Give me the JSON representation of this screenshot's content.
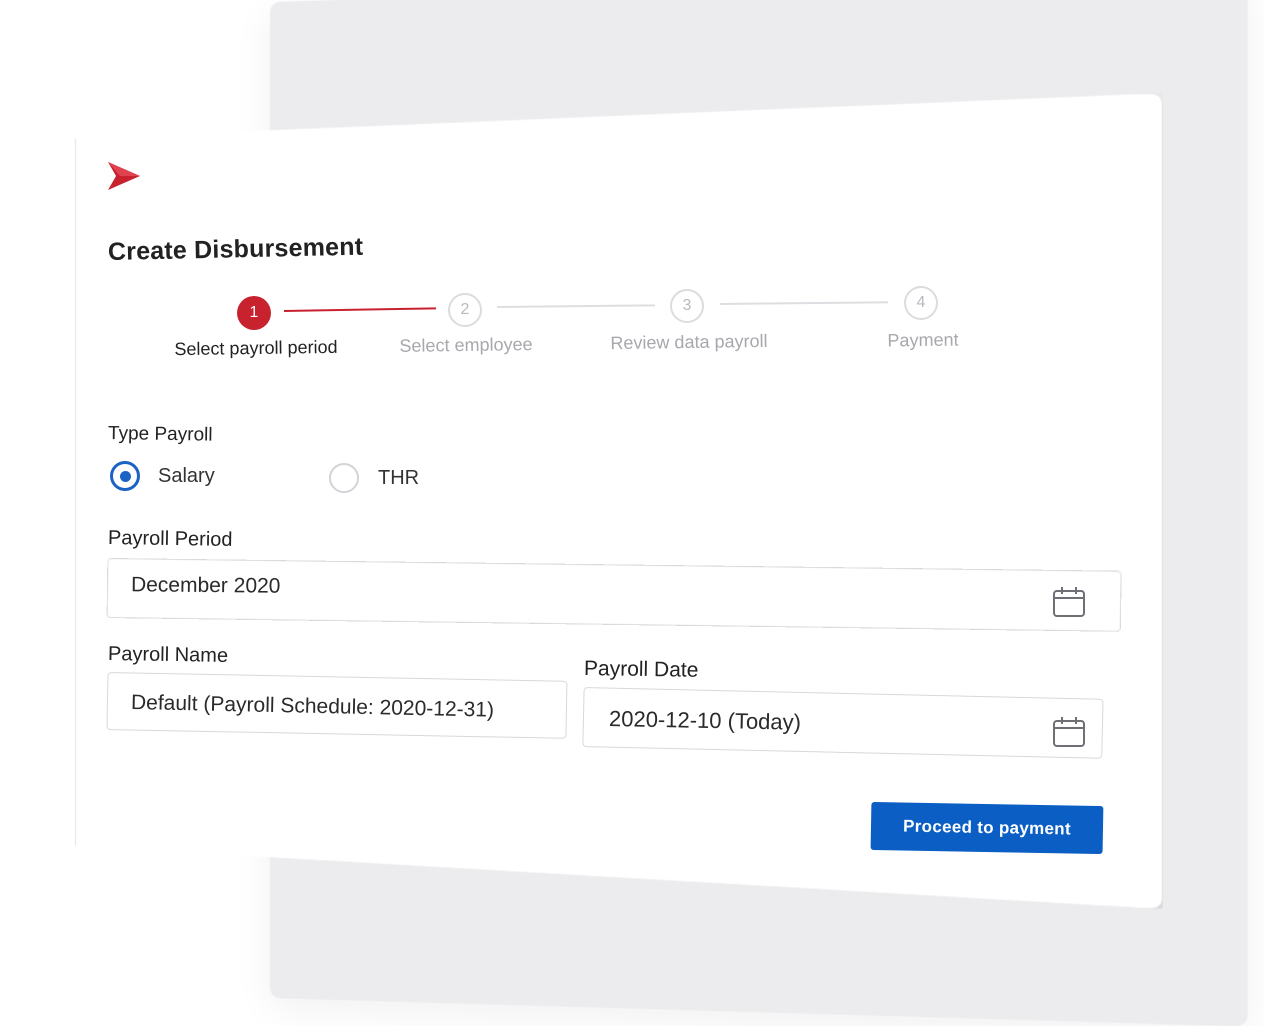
{
  "dialog": {
    "title": "Create Disbursement",
    "brand_color": "#c8222f",
    "accent_color": "#0b5fc4"
  },
  "stepper": {
    "steps": [
      {
        "number": "1",
        "label": "Select payroll period",
        "state": "active"
      },
      {
        "number": "2",
        "label": "Select employee",
        "state": "inactive"
      },
      {
        "number": "3",
        "label": "Review data payroll",
        "state": "inactive"
      },
      {
        "number": "4",
        "label": "Payment",
        "state": "inactive"
      }
    ]
  },
  "type_payroll": {
    "label": "Type Payroll",
    "options": [
      {
        "label": "Salary",
        "selected": true
      },
      {
        "label": "THR",
        "selected": false
      }
    ]
  },
  "payroll_period": {
    "label": "Payroll Period",
    "value": "December 2020",
    "icon": "calendar-icon"
  },
  "payroll_name": {
    "label": "Payroll Name",
    "value": "Default (Payroll Schedule: 2020-12-31)"
  },
  "payroll_date": {
    "label": "Payroll Date",
    "value": "2020-12-10 (Today)",
    "icon": "calendar-icon"
  },
  "actions": {
    "proceed_label": "Proceed to payment"
  }
}
